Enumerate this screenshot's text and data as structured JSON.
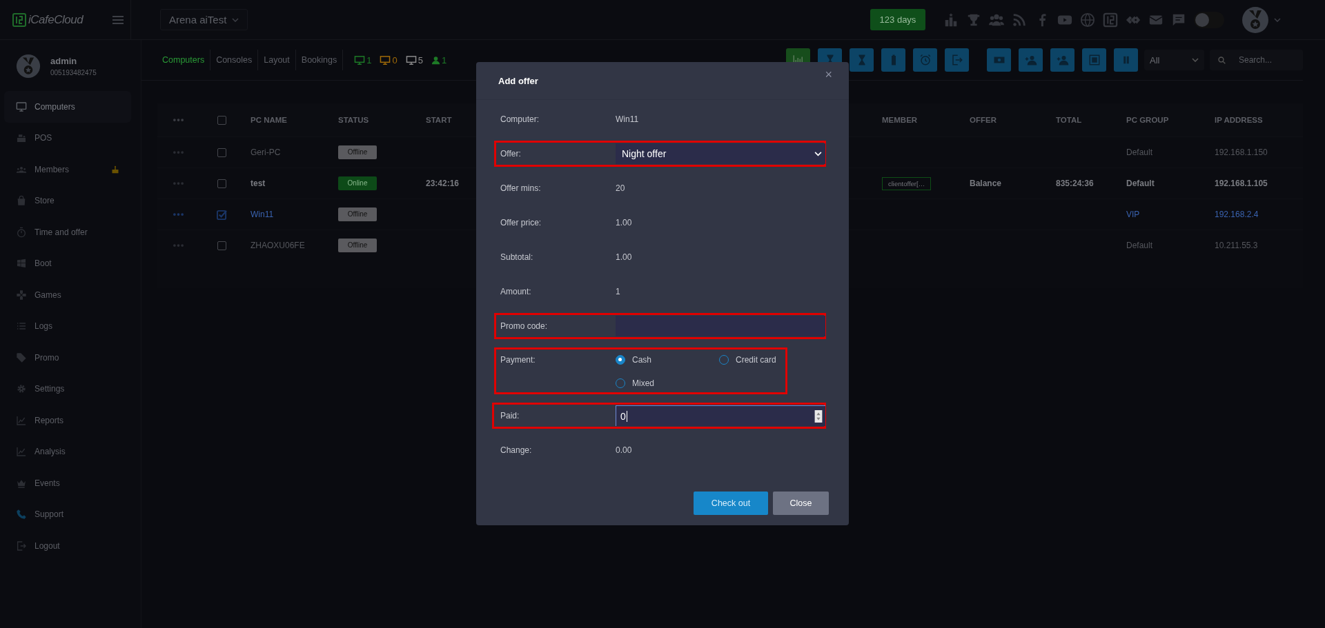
{
  "topbar": {
    "brand": "iCafeCloud",
    "arena": "Arena aiTest",
    "days": "123 days",
    "dark_toggle_on": false
  },
  "user": {
    "name": "admin",
    "id": "005193482475"
  },
  "sidebar": {
    "items": [
      {
        "label": "Computers",
        "selected": true,
        "badge": false
      },
      {
        "label": "POS",
        "selected": false,
        "badge": false
      },
      {
        "label": "Members",
        "selected": false,
        "badge": true
      },
      {
        "label": "Store",
        "selected": false,
        "badge": false
      },
      {
        "label": "Time and offer",
        "selected": false,
        "badge": false
      },
      {
        "label": "Boot",
        "selected": false,
        "badge": false
      },
      {
        "label": "Games",
        "selected": false,
        "badge": false
      },
      {
        "label": "Logs",
        "selected": false,
        "badge": false
      },
      {
        "label": "Promo",
        "selected": false,
        "badge": false
      },
      {
        "label": "Settings",
        "selected": false,
        "badge": false
      },
      {
        "label": "Reports",
        "selected": false,
        "badge": false
      },
      {
        "label": "Analysis",
        "selected": false,
        "badge": false
      },
      {
        "label": "Events",
        "selected": false,
        "badge": false
      },
      {
        "label": "Support",
        "selected": false,
        "badge": false
      },
      {
        "label": "Logout",
        "selected": false,
        "badge": false
      }
    ]
  },
  "tabs": [
    {
      "label": "Computers",
      "selected": true
    },
    {
      "label": "Consoles",
      "selected": false
    },
    {
      "label": "Layout",
      "selected": false
    },
    {
      "label": "Bookings",
      "selected": false
    }
  ],
  "stats": [
    {
      "kind": "pc",
      "count": "1",
      "color": "#1d7a26"
    },
    {
      "kind": "pc",
      "count": "0",
      "color": "#a06a08"
    },
    {
      "kind": "pc",
      "count": "5",
      "color": "#8a8a8a"
    },
    {
      "kind": "user",
      "count": "1",
      "color": "#1d7a26"
    }
  ],
  "filter": {
    "value": "All"
  },
  "search": {
    "placeholder": "Search..."
  },
  "table": {
    "all_selected": false,
    "columns": [
      "PC NAME",
      "STATUS",
      "START",
      "MEMBER",
      "OFFER",
      "TOTAL",
      "PC GROUP",
      "IP ADDRESS"
    ],
    "rows": [
      {
        "name": "Geri-PC",
        "selected": false,
        "status": "Offline",
        "online": false,
        "group": "Default",
        "ip": "192.168.1.150"
      },
      {
        "name": "test",
        "selected": false,
        "status": "Online",
        "online": true,
        "start": "23:42:16",
        "member": "clientoffer[…",
        "offer": "Balance",
        "total": "835:24:36",
        "group": "Default",
        "ip": "192.168.1.105"
      },
      {
        "name": "Win11",
        "selected": true,
        "status": "Offline",
        "online": false,
        "group": "VIP",
        "ip": "192.168.2.4"
      },
      {
        "name": "ZHAOXU06FE",
        "selected": false,
        "status": "Offline",
        "online": false,
        "group": "Default",
        "ip": "10.211.55.3"
      }
    ]
  },
  "modal": {
    "title": "Add offer",
    "close": "×",
    "fields": [
      {
        "kind": "text",
        "label": "Computer:",
        "value": "Win11",
        "highlighted": false
      },
      {
        "kind": "select",
        "label": "Offer:",
        "value": "Night offer",
        "highlighted": true
      },
      {
        "kind": "text",
        "label": "Offer mins:",
        "value": "20",
        "highlighted": false
      },
      {
        "kind": "text",
        "label": "Offer price:",
        "value": "1.00",
        "highlighted": false
      },
      {
        "kind": "text",
        "label": "Subtotal:",
        "value": "1.00",
        "highlighted": false
      },
      {
        "kind": "text",
        "label": "Amount:",
        "value": "1",
        "highlighted": false
      },
      {
        "kind": "input",
        "label": "Promo code:",
        "highlighted": true
      },
      {
        "kind": "radio",
        "label": "Payment:",
        "highlighted": true,
        "options": [
          {
            "label": "Cash",
            "selected": true
          },
          {
            "label": "Credit card",
            "selected": false
          },
          {
            "label": "Mixed",
            "selected": false
          }
        ]
      },
      {
        "kind": "number",
        "label": "Paid:",
        "value": "0",
        "highlighted": true
      },
      {
        "kind": "text",
        "label": "Change:",
        "value": "0.00",
        "highlighted": false
      }
    ],
    "buttons": [
      {
        "label": "Check out",
        "kind": "primary"
      },
      {
        "label": "Close",
        "kind": "secondary"
      }
    ]
  }
}
